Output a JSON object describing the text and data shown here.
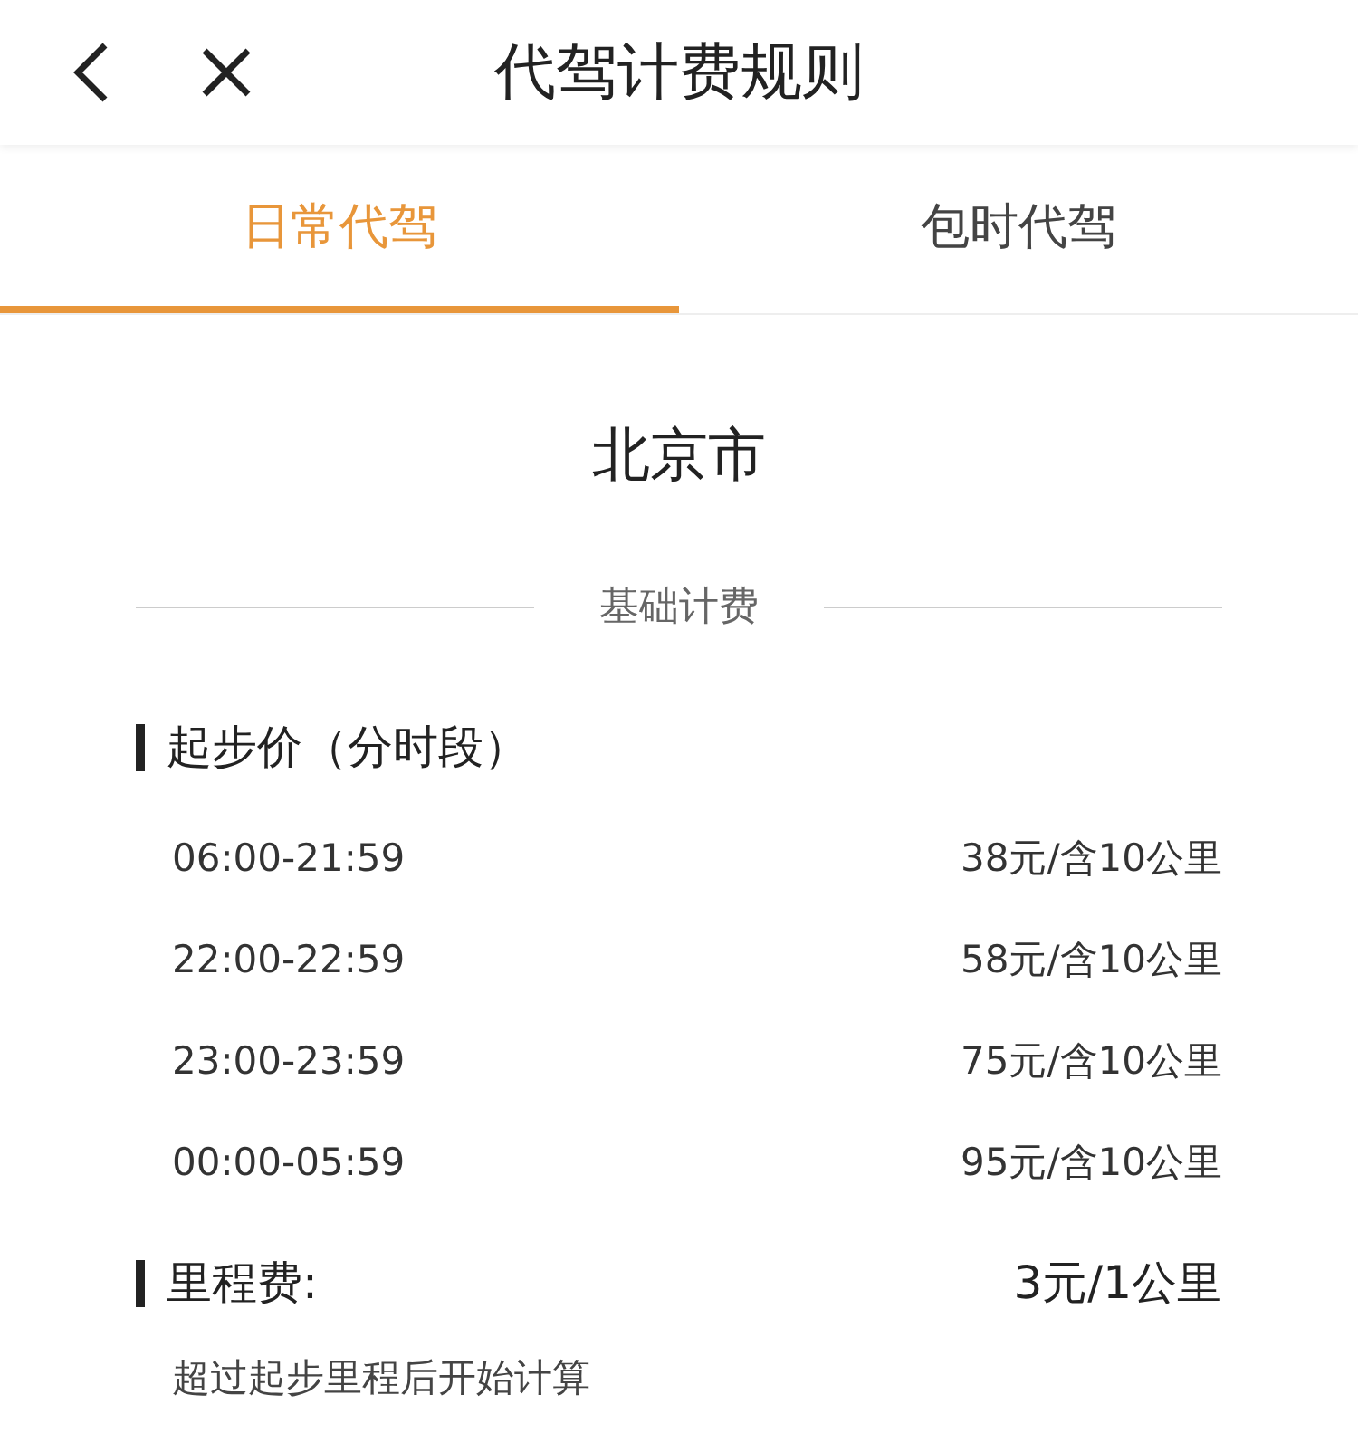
{
  "header": {
    "title": "代驾计费规则"
  },
  "tabs": [
    {
      "label": "日常代驾",
      "selected": true
    },
    {
      "label": "包时代驾",
      "selected": false
    }
  ],
  "city": "北京市",
  "section_title": "基础计费",
  "start_price": {
    "title": "起步价（分时段）",
    "rows": [
      {
        "time": "06:00-21:59",
        "price": "38元/含10公里"
      },
      {
        "time": "22:00-22:59",
        "price": "58元/含10公里"
      },
      {
        "time": "23:00-23:59",
        "price": "75元/含10公里"
      },
      {
        "time": "00:00-05:59",
        "price": "95元/含10公里"
      }
    ]
  },
  "mileage": {
    "title": "里程费:",
    "price": "3元/1公里",
    "note": "超过起步里程后开始计算"
  }
}
